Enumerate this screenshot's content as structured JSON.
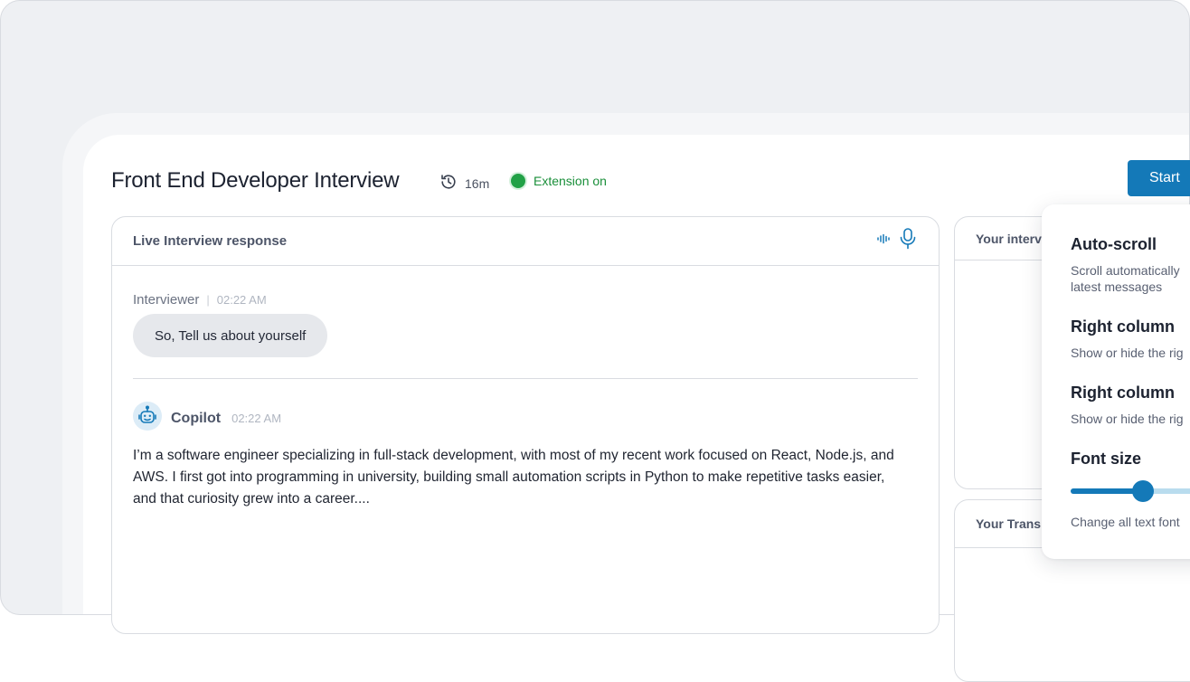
{
  "header": {
    "title": "Front End Developer Interview",
    "duration": "16m",
    "extension_status": "Extension on",
    "start_label": "Start"
  },
  "live_panel": {
    "title": "Live Interview response",
    "interviewer": {
      "name": "Interviewer",
      "time": "02:22 AM",
      "message": "So, Tell us about yourself"
    },
    "copilot": {
      "name": "Copilot",
      "time": "02:22 AM",
      "message": "I’m a software engineer specializing in full-stack development, with most of my recent work focused on React, Node.js, and AWS. I first got into programming in university, building small automation scripts in Python to make repetitive tasks easier, and that curiosity grew into a career...."
    }
  },
  "side_panels": {
    "top_title": "Your interv",
    "bottom_title": "Your Trans"
  },
  "settings_popover": {
    "options": [
      {
        "title": "Auto-scroll",
        "desc_line1": "Scroll automatically",
        "desc_line2": "latest messages"
      },
      {
        "title": "Right column",
        "desc_line1": "Show or hide the rig"
      },
      {
        "title": "Right column",
        "desc_line1": "Show or hide the rig"
      },
      {
        "title": "Font size",
        "desc_line1": "Change all text font"
      }
    ],
    "font_size_slider_fraction": 0.4
  },
  "colors": {
    "accent": "#1479b8",
    "status_green": "#21a146",
    "bubble_bg": "#e6e8ec"
  },
  "icons": [
    "history-icon",
    "audio-wave-icon",
    "microphone-icon",
    "copilot-bot-icon"
  ]
}
